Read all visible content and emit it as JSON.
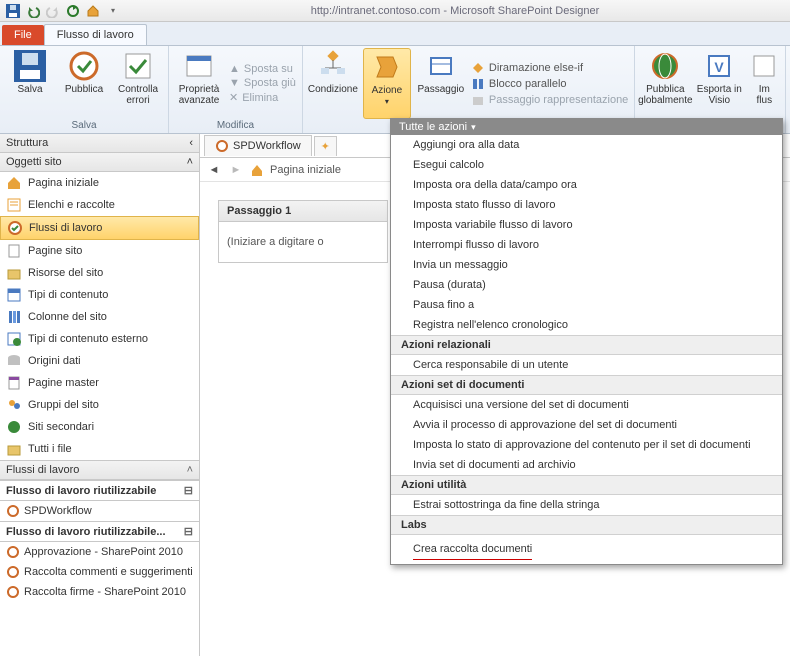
{
  "window": {
    "title": "http://intranet.contoso.com - Microsoft SharePoint Designer"
  },
  "tabs": {
    "file": "File",
    "workflow": "Flusso di lavoro"
  },
  "ribbon": {
    "save_group": "Salva",
    "edit_group": "Modifica",
    "save": "Salva",
    "publish": "Pubblica",
    "check": "Controlla errori",
    "advprops": "Proprietà avanzate",
    "moveup": "Sposta su",
    "movedown": "Sposta giù",
    "delete": "Elimina",
    "condition": "Condizione",
    "action": "Azione",
    "step": "Passaggio",
    "branch": "Diramazione else-if",
    "parallel": "Blocco parallelo",
    "impersonate": "Passaggio rappresentazione",
    "pubglobal": "Pubblica globalmente",
    "export": "Esporta in Visio",
    "import": "Importa flusso"
  },
  "sidebar": {
    "struct": "Struttura",
    "objects": "Oggetti sito",
    "items": [
      "Pagina iniziale",
      "Elenchi e raccolte",
      "Flussi di lavoro",
      "Pagine sito",
      "Risorse del sito",
      "Tipi di contenuto",
      "Colonne del sito",
      "Tipi di contenuto esterno",
      "Origini dati",
      "Pagine master",
      "Gruppi del sito",
      "Siti secondari",
      "Tutti i file"
    ],
    "wf_header": "Flussi di lavoro",
    "wf_reuse1": "Flusso di lavoro riutilizzabile",
    "wf_spd": "SPDWorkflow",
    "wf_reuse2": "Flusso di lavoro riutilizzabile...",
    "wf_approve": "Approvazione - SharePoint 2010",
    "wf_comments": "Raccolta commenti e suggerimenti",
    "wf_sign": "Raccolta firme - SharePoint 2010"
  },
  "doc": {
    "tab": "SPDWorkflow",
    "crumb": "Pagina iniziale",
    "step_title": "Passaggio 1",
    "step_hint": "(Iniziare a digitare o"
  },
  "dropdown": {
    "title": "Tutte le azioni",
    "core_items": [
      "Aggiungi ora alla data",
      "Esegui calcolo",
      "Imposta ora della data/campo ora",
      "Imposta stato flusso di lavoro",
      "Imposta variabile flusso di lavoro",
      "Interrompi flusso di lavoro",
      "Invia un messaggio",
      "Pausa (durata)",
      "Pausa fino a",
      "Registra nell'elenco cronologico"
    ],
    "rel_header": "Azioni relazionali",
    "rel_items": [
      "Cerca responsabile di un utente"
    ],
    "set_header": "Azioni set di documenti",
    "set_items": [
      "Acquisisci una versione del set di documenti",
      "Avvia il processo di approvazione del set di documenti",
      "Imposta lo stato di approvazione del contenuto per il set di documenti",
      "Invia set di documenti ad archivio"
    ],
    "util_header": "Azioni utilità",
    "util_items": [
      "Estrai sottostringa da fine della stringa"
    ],
    "labs_header": "Labs",
    "labs_item": "Crea raccolta documenti"
  }
}
